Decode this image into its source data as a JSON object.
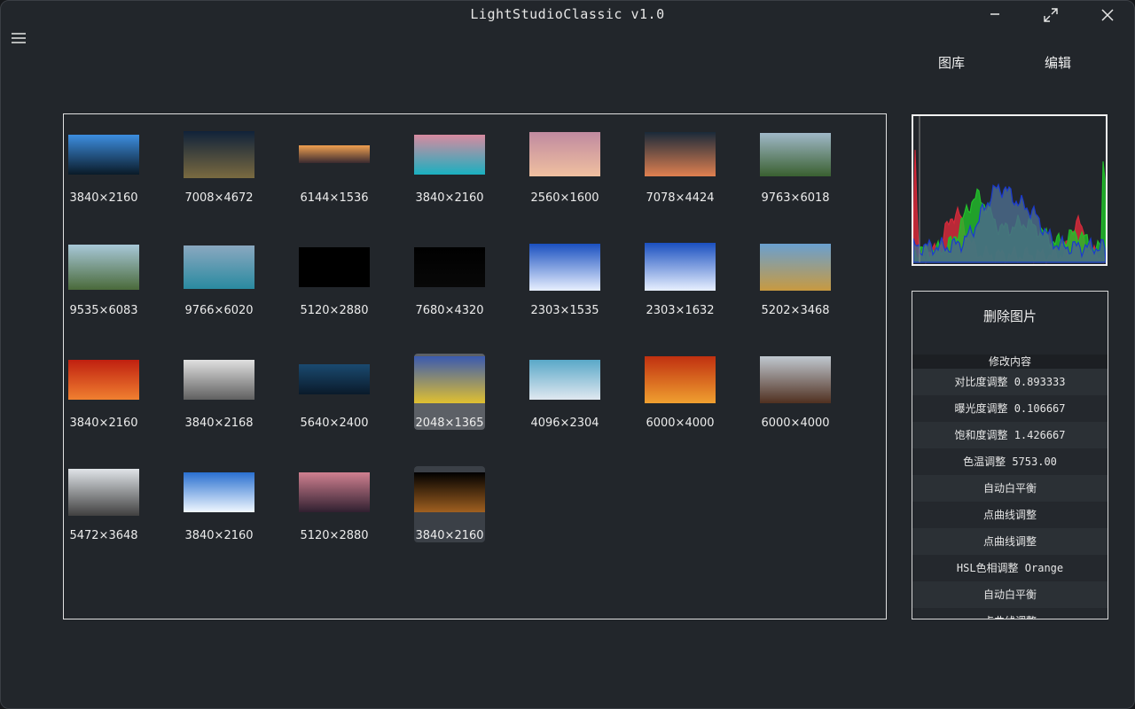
{
  "app": {
    "title": "LightStudioClassic v1.0"
  },
  "nav": {
    "gallery_label": "图库",
    "edit_label": "编辑"
  },
  "gallery": {
    "images": [
      {
        "size": "3840×2160",
        "colors": [
          "#3d8ee0",
          "#0a1a28"
        ]
      },
      {
        "size": "7008×4672",
        "colors": [
          "#10223a",
          "#7a6a40"
        ]
      },
      {
        "size": "6144×1536",
        "colors": [
          "#f0a050",
          "#3a2a30"
        ]
      },
      {
        "size": "3840×2160",
        "colors": [
          "#d88aa0",
          "#1ab0c0"
        ]
      },
      {
        "size": "2560×1600",
        "colors": [
          "#c08aa0",
          "#f0c0a0"
        ]
      },
      {
        "size": "7078×4424",
        "colors": [
          "#1a2a3a",
          "#e08050"
        ]
      },
      {
        "size": "9763×6018",
        "colors": [
          "#a0b8c8",
          "#3a6030"
        ]
      },
      {
        "size": "9535×6083",
        "colors": [
          "#a8c8d8",
          "#4a6a3a"
        ]
      },
      {
        "size": "9766×6020",
        "colors": [
          "#8aa8c0",
          "#2a8aa0"
        ]
      },
      {
        "size": "5120×2880",
        "colors": [
          "#000000",
          "#000000"
        ]
      },
      {
        "size": "7680×4320",
        "colors": [
          "#000000",
          "#080808"
        ]
      },
      {
        "size": "2303×1535",
        "colors": [
          "#1a50c0",
          "#e8f0ff"
        ]
      },
      {
        "size": "2303×1632",
        "colors": [
          "#1a50c0",
          "#e8f0ff"
        ]
      },
      {
        "size": "5202×3468",
        "colors": [
          "#6aa0d0",
          "#c89a40"
        ]
      },
      {
        "size": "3840×2160",
        "colors": [
          "#c02010",
          "#f08030"
        ]
      },
      {
        "size": "3840×2168",
        "colors": [
          "#e0e0e0",
          "#606060"
        ]
      },
      {
        "size": "5640×2400",
        "colors": [
          "#1a4a70",
          "#0a1a2a"
        ]
      },
      {
        "size": "2048×1365",
        "colors": [
          "#3a5ab0",
          "#e0c030"
        ]
      },
      {
        "size": "4096×2304",
        "colors": [
          "#5aa8c8",
          "#e0e8f0"
        ]
      },
      {
        "size": "6000×4000",
        "colors": [
          "#c03010",
          "#f0a030"
        ]
      },
      {
        "size": "6000×4000",
        "colors": [
          "#c0c8d0",
          "#503020"
        ]
      },
      {
        "size": "5472×3648",
        "colors": [
          "#e0e4e8",
          "#404040"
        ]
      },
      {
        "size": "3840×2160",
        "colors": [
          "#2a70d0",
          "#f0f8ff"
        ]
      },
      {
        "size": "5120×2880",
        "colors": [
          "#d08090",
          "#302030"
        ]
      },
      {
        "size": "3840×2160",
        "colors": [
          "#000000",
          "#a06020"
        ]
      }
    ],
    "selected_index": 17,
    "hover_index": 24
  },
  "histogram": {
    "colors": {
      "red": "#d42a3a",
      "green": "#22c02a",
      "blue": "#1a3ad0",
      "fill": "#4a6a8a"
    }
  },
  "edit_panel": {
    "delete_label": "删除图片",
    "history_header": "修改内容",
    "history": [
      "对比度调整 0.893333",
      "曝光度调整 0.106667",
      "饱和度调整 1.426667",
      "色温调整 5753.00",
      "自动白平衡",
      "点曲线调整",
      "点曲线调整",
      "HSL色相调整 Orange",
      "自动白平衡",
      "点曲线调整"
    ]
  }
}
